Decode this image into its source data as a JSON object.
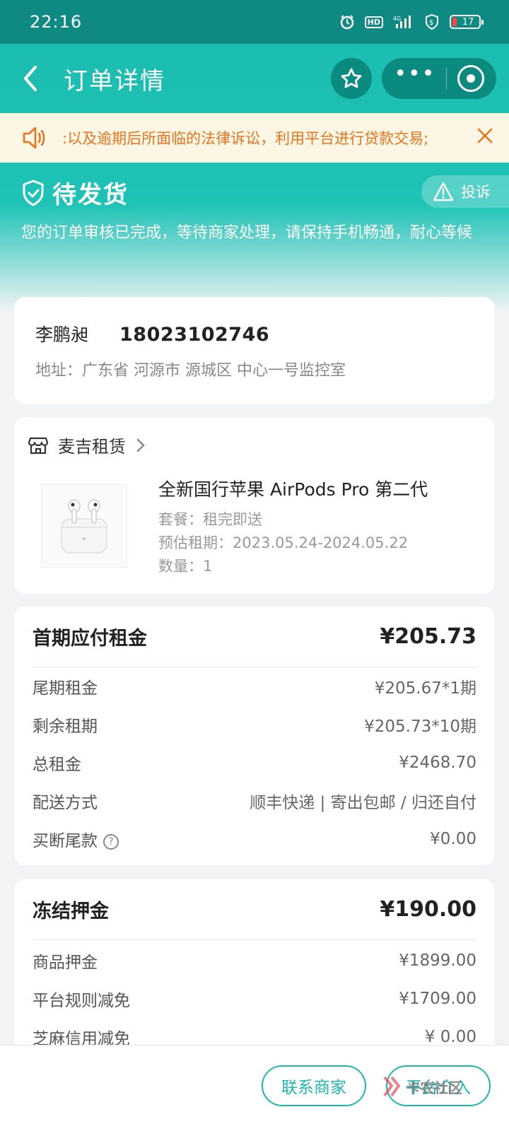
{
  "status_bar": {
    "time": "22:16",
    "icons": [
      "alarm-icon",
      "hd-icon",
      "signal-4g-icon",
      "shield-icon",
      "battery-icon"
    ],
    "hd_label": "HD",
    "battery_level": "17"
  },
  "nav": {
    "title": "订单详情",
    "capsule_dots": "•••"
  },
  "notice": {
    "text": ":以及逾期后所面临的法律诉讼，利用平台进行贷款交易;"
  },
  "order_status": {
    "title": "待发货",
    "complaint_label": "投诉",
    "description": "您的订单审核已完成，等待商家处理，请保持手机畅通，耐心等候"
  },
  "address": {
    "name": "李鹏昶",
    "phone": "18023102746",
    "address_text": "地址：广东省 河源市 源城区 中心一号监控室"
  },
  "product": {
    "shop_name": "麦吉租赁",
    "title": "全新国行苹果 AirPods Pro 第二代",
    "package": "套餐：租完即送",
    "period": "预估租期：2023.05.24-2024.05.22",
    "quantity": "数量：1"
  },
  "fees": {
    "head_label": "首期应付租金",
    "head_value": "¥205.73",
    "rows": [
      {
        "label": "尾期租金",
        "value": "¥205.67*1期"
      },
      {
        "label": "剩余租期",
        "value": "¥205.73*10期"
      },
      {
        "label": "总租金",
        "value": "¥2468.70"
      },
      {
        "label": "配送方式",
        "value": "顺丰快递 | 寄出包邮 / 归还自付"
      },
      {
        "label": "买断尾款",
        "value": "¥0.00"
      }
    ]
  },
  "deposit": {
    "head_label": "冻结押金",
    "head_value": "¥190.00",
    "rows": [
      {
        "label": "商品押金",
        "value": "¥1899.00"
      },
      {
        "label": "平台规则减免",
        "value": "¥1709.00"
      },
      {
        "label": "芝麻信用减免",
        "value": "¥ 0.00"
      }
    ]
  },
  "bottom": {
    "contact_label": "联系商家",
    "platform_label": "平台介入",
    "watermark": "卡农社区"
  },
  "colors": {
    "brand": "#1cb8ac",
    "status_bar": "#0f8a82",
    "notice_text": "#e8741e",
    "notice_bg": "#fef6e4"
  }
}
